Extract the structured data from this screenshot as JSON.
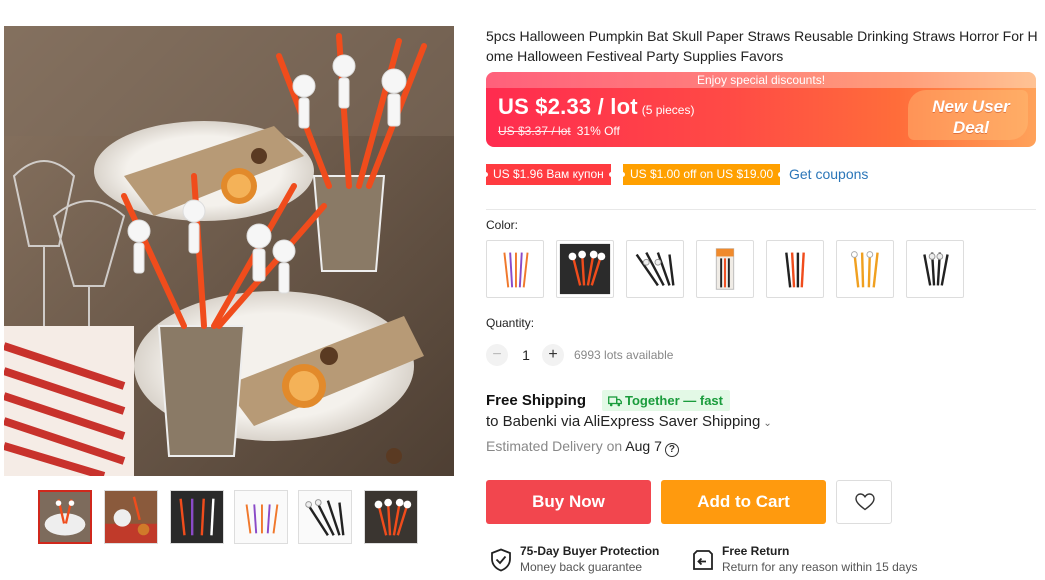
{
  "product": {
    "title": "5pcs Halloween Pumpkin Bat Skull Paper Straws Reusable Drinking Straws Horror For Home Halloween Festiveal Party Supplies Favors"
  },
  "gallery": {
    "thumbnails": [
      "thumbnail-1",
      "thumbnail-2",
      "thumbnail-3",
      "thumbnail-4",
      "thumbnail-5",
      "thumbnail-6"
    ],
    "active_index": 0
  },
  "price": {
    "promo_strip": "Enjoy special discounts!",
    "current": "US $2.33 / lot",
    "pieces": "(5 pieces)",
    "original": "US $3.37 / lot",
    "discount": "31% Off",
    "badge_line1": "New User",
    "badge_line2": "Deal"
  },
  "coupons": {
    "coupon_1": "US $1.96 Вам купон",
    "coupon_2": "US $1.00 off on US $19.00",
    "get_coupons": "Get coupons"
  },
  "options": {
    "color_label": "Color:",
    "quantity_label": "Quantity:",
    "quantity_value": "1",
    "quantity_minus": "−",
    "quantity_plus": "+",
    "available": "6993 lots available"
  },
  "shipping": {
    "title": "Free Shipping",
    "badge": "Together — fast",
    "route": "to Babenki via AliExpress Saver Shipping",
    "delivery_prefix": "Estimated Delivery on",
    "delivery_date": "Aug 7"
  },
  "actions": {
    "buy_now": "Buy Now",
    "add_to_cart": "Add to Cart"
  },
  "guarantees": {
    "protection_title": "75-Day Buyer Protection",
    "protection_sub": "Money back guarantee",
    "return_title": "Free Return",
    "return_sub": "Return for any reason within 15 days"
  },
  "colors": {
    "price_gradient_start": "#ff2b4f",
    "price_gradient_end": "#ffa25a",
    "buy_now": "#f2464e",
    "add_to_cart": "#ff9a0e",
    "coupon_red": "#ff3b40",
    "coupon_orange": "#ffa000",
    "link": "#2b76b8",
    "together_text": "#1a9c3c",
    "straw_orange": "#f04c1c"
  }
}
